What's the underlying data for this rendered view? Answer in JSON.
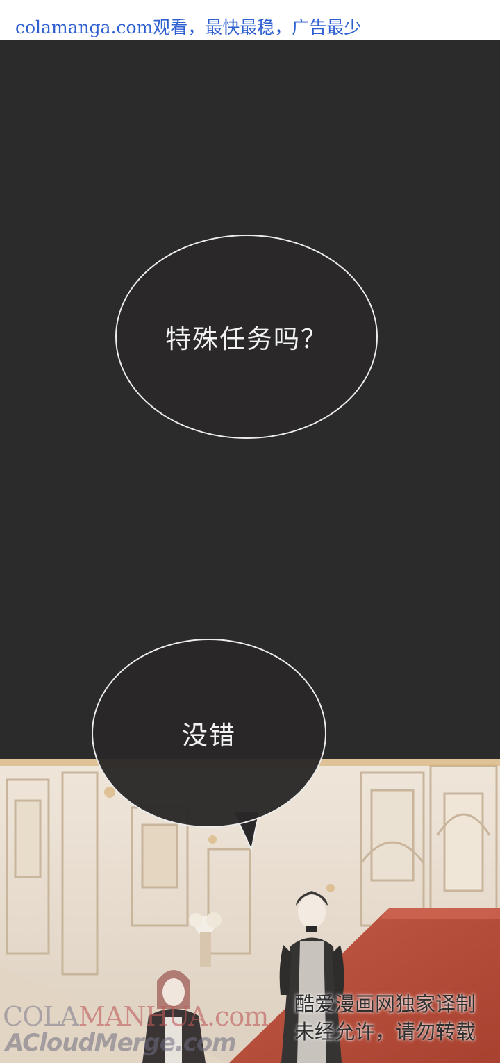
{
  "banner": {
    "text": "colamanga.com观看，最快最稳，广告最少"
  },
  "bubbles": [
    {
      "text": "特殊任务吗？"
    },
    {
      "text": "没错"
    }
  ],
  "watermark_left": {
    "line1_a": "COLA",
    "line1_b": "MANHUA",
    "line1_c": ".com",
    "line2": "ACloudMerge.com"
  },
  "watermark_right": {
    "line1": "酷爱漫画网独家译制",
    "line2": "未经允许，请勿转载"
  },
  "colors": {
    "banner_link": "#2d5fd0",
    "panel_dark": "#2b2b2b",
    "bubble_border": "#ececec",
    "carpet": "#b84a3c"
  }
}
